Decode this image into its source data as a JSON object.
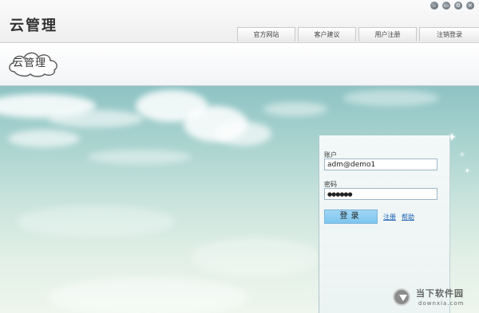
{
  "header": {
    "brand": "云管理",
    "nav_tabs": [
      {
        "label": "官方网站"
      },
      {
        "label": "客户建议"
      },
      {
        "label": "用户注册"
      },
      {
        "label": "注销登录"
      }
    ],
    "window_controls": [
      {
        "icon": "minimize-icon",
        "glyph": "–"
      },
      {
        "icon": "restore-icon",
        "glyph": "▭"
      },
      {
        "icon": "settings-icon",
        "glyph": "⚙"
      },
      {
        "icon": "close-icon",
        "glyph": "×"
      }
    ]
  },
  "logo": {
    "text": "云管理"
  },
  "login": {
    "account_label": "账户",
    "account_value": "adm@demo1",
    "password_label": "密码",
    "password_value": "●●●●●●",
    "login_button": "登录",
    "register_link": "注册",
    "help_link": "帮助"
  },
  "watermark": {
    "title": "当下软件园",
    "url": "downxia.com"
  },
  "colors": {
    "sky_top": "#8ec3c4",
    "sky_bottom": "#eef6ee",
    "button": "#8ecdf2",
    "link": "#1a5fb4"
  }
}
